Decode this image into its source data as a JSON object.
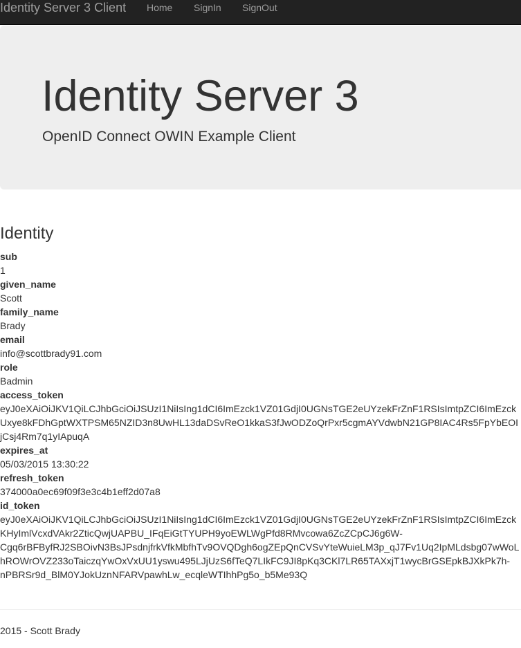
{
  "navbar": {
    "brand": "Identity Server 3 Client",
    "links": [
      "Home",
      "SignIn",
      "SignOut"
    ]
  },
  "jumbotron": {
    "title": "Identity Server 3",
    "subtitle": "OpenID Connect OWIN Example Client"
  },
  "identity": {
    "heading": "Identity",
    "claims": [
      {
        "key": "sub",
        "value": [
          "1"
        ]
      },
      {
        "key": "given_name",
        "value": [
          "Scott"
        ]
      },
      {
        "key": "family_name",
        "value": [
          "Brady"
        ]
      },
      {
        "key": "email",
        "value": [
          "info@scottbrady91.com"
        ]
      },
      {
        "key": "role",
        "value": [
          "Badmin"
        ]
      },
      {
        "key": "access_token",
        "value": [
          "eyJ0eXAiOiJKV1QiLCJhbGciOiJSUzI1NiIsIng1dCI6ImEzck1VZ01GdjI0UGNsTGE2eUYzekFrZnF1RSIsImtpZCI6ImEzck",
          "Uxye8kFDhGptWXTPSM65NZID3n8UwHL13daDSvReO1kkaS3fJwODZoQrPxr5cgmAYVdwbN21GP8IAC4Rs5FpYbEOI",
          "jCsj4Rm7q1yIApuqA"
        ]
      },
      {
        "key": "expires_at",
        "value": [
          "05/03/2015 13:30:22"
        ]
      },
      {
        "key": "refresh_token",
        "value": [
          "374000a0ec69f09f3e3c4b1eff2d07a8"
        ]
      },
      {
        "key": "id_token",
        "value": [
          "eyJ0eXAiOiJKV1QiLCJhbGciOiJSUzI1NiIsIng1dCI6ImEzck1VZ01GdjI0UGNsTGE2eUYzekFrZnF1RSIsImtpZCI6ImEzck",
          "KHyImlVcxdVAkr2ZticQwjUAPBU_IFqEiGtTYUPH9yoEWLWgPfd8RMvcowa6ZcZCpCJ6g6W-",
          "Cgq6rBFByfRJ2SBOivN3BsJPsdnjfrkVfkMbfhTv9OVQDgh6ogZEpQnCVSvYteWuieLM3p_qJ7Fv1Uq2IpMLdsbg07wWoL",
          "hROWrOVZ233oTaiczqYwOxVxUU1yswu495LJjUzS6fTeQ7LIkFC9JI8pKq3CKl7LR65TAXxjT1wycBrGSEpkBJXkPk7h-",
          "nPBRSr9d_BlM0YJokUznNFARVpawhLw_ecqleWTIhhPg5o_b5Me93Q"
        ]
      }
    ]
  },
  "footer": {
    "text": "2015 - Scott Brady"
  }
}
